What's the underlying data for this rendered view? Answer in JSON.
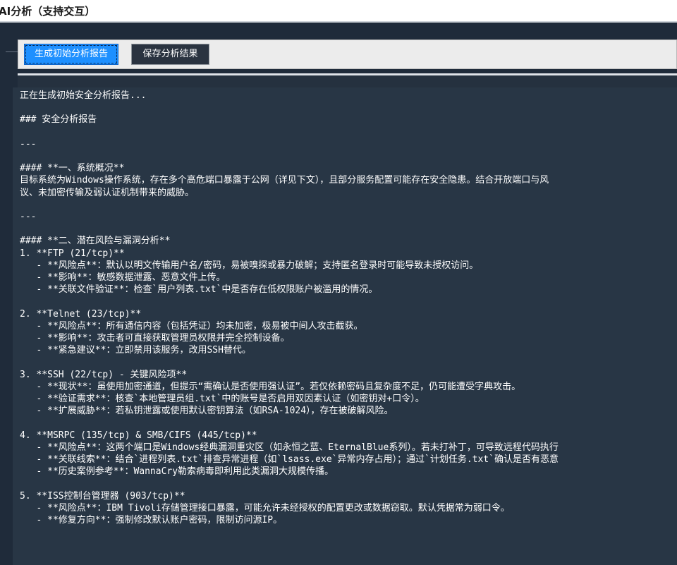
{
  "window": {
    "title": "AI分析（支持交互）"
  },
  "toolbar": {
    "generate_label": "生成初始分析报告",
    "save_label": "保存分析结果"
  },
  "output": {
    "lines": [
      "正在生成初始安全分析报告...",
      "",
      "### 安全分析报告",
      "",
      "---",
      "",
      "#### **一、系统概况**",
      "目标系统为Windows操作系统，存在多个高危端口暴露于公网（详见下文），且部分服务配置可能存在安全隐患。结合开放端口与风",
      "议、未加密传输及弱认证机制带来的威胁。",
      "",
      "---",
      "",
      "#### **二、潜在风险与漏洞分析**",
      "1. **FTP (21/tcp)**",
      "   - **风险点**：默认以明文传输用户名/密码，易被嗅探或暴力破解；支持匿名登录时可能导致未授权访问。",
      "   - **影响**：敏感数据泄露、恶意文件上传。",
      "   - **关联文件验证**：检查`用户列表.txt`中是否存在低权限账户被滥用的情况。",
      "",
      "2. **Telnet (23/tcp)**",
      "   - **风险点**：所有通信内容（包括凭证）均未加密，极易被中间人攻击截获。",
      "   - **影响**：攻击者可直接获取管理员权限并完全控制设备。",
      "   - **紧急建议**：立即禁用该服务，改用SSH替代。",
      "",
      "3. **SSH (22/tcp) - 关键风险项**",
      "   - **现状**：虽使用加密通道，但提示“需确认是否使用强认证”。若仅依赖密码且复杂度不足，仍可能遭受字典攻击。",
      "   - **验证需求**：核查`本地管理员组.txt`中的账号是否启用双因素认证（如密钥对+口令）。",
      "   - **扩展威胁**：若私钥泄露或使用默认密钥算法（如RSA-1024），存在被破解风险。",
      "",
      "4. **MSRPC (135/tcp) & SMB/CIFS (445/tcp)**",
      "   - **风险点**：这两个端口是Windows经典漏洞重灾区（如永恒之蓝、EternalBlue系列）。若未打补丁，可导致远程代码执行",
      "   - **关联线索**：结合`进程列表.txt`排查异常进程（如`lsass.exe`异常内存占用）；通过`计划任务.txt`确认是否有恶意",
      "   - **历史案例参考**：WannaCry勒索病毒即利用此类漏洞大规模传播。",
      "",
      "5. **ISS控制台管理器 (903/tcp)**",
      "   - **风险点**：IBM Tivoli存储管理接口暴露，可能允许未经授权的配置更改或数据窃取。默认凭据常为弱口令。",
      "   - **修复方向**：强制修改默认账户密码，限制访问源IP。"
    ]
  }
}
